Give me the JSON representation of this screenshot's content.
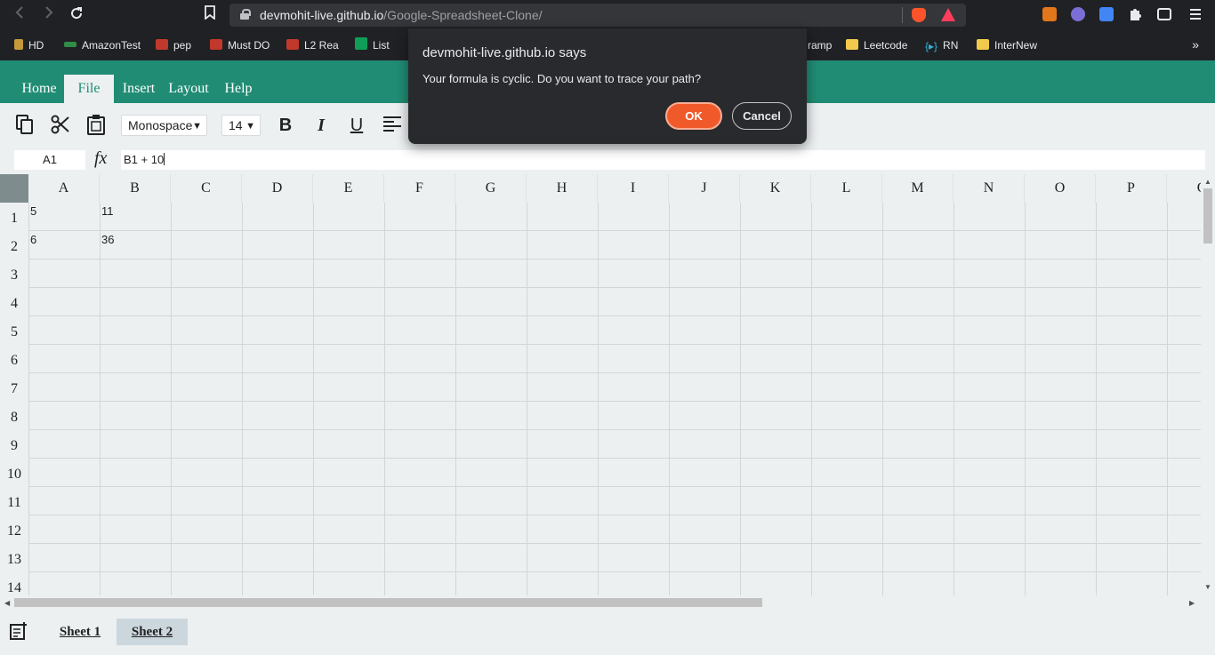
{
  "browser": {
    "url_domain": "devmohit-live.github.io",
    "url_path": "/Google-Spreadsheet-Clone/",
    "bookmarks": [
      {
        "label": "HD",
        "icon": "hd-icon"
      },
      {
        "label": "AmazonTest",
        "icon": "gfg-icon"
      },
      {
        "label": "pep",
        "icon": "pep-icon"
      },
      {
        "label": "Must DO",
        "icon": "pep-icon"
      },
      {
        "label": "L2 Rea",
        "icon": "pep-icon"
      },
      {
        "label": "List",
        "icon": "sheets-icon"
      },
      {
        "label": "ramp",
        "icon": ""
      },
      {
        "label": "Leetcode",
        "icon": "folder-icon"
      },
      {
        "label": "RN",
        "icon": "rn-icon"
      },
      {
        "label": "InterNew",
        "icon": "folder-icon"
      }
    ],
    "more_bookmarks": "»"
  },
  "dialog": {
    "title": "devmohit-live.github.io says",
    "message": "Your formula is cyclic. Do you want to trace your path?",
    "ok_label": "OK",
    "cancel_label": "Cancel"
  },
  "menu": {
    "items": [
      "Home",
      "File",
      "Insert",
      "Layout",
      "Help"
    ],
    "active": "File"
  },
  "toolbar": {
    "font_family": "Monospace",
    "font_size": "14",
    "bold_label": "B",
    "italic_label": "I",
    "underline_label": "U"
  },
  "formula_bar": {
    "cell_address": "A1",
    "fx_label": "fx",
    "formula": "B1 + 10"
  },
  "grid": {
    "columns": [
      "A",
      "B",
      "C",
      "D",
      "E",
      "F",
      "G",
      "H",
      "I",
      "J",
      "K",
      "L",
      "M",
      "N",
      "O",
      "P",
      "Q"
    ],
    "rows": [
      "1",
      "2",
      "3",
      "4",
      "5",
      "6",
      "7",
      "8",
      "9",
      "10",
      "11",
      "12",
      "13",
      "14"
    ],
    "cells": {
      "A1": "5",
      "B1": "11",
      "A2": "6",
      "B2": "36"
    }
  },
  "sheets": {
    "tabs": [
      "Sheet 1",
      "Sheet 2"
    ],
    "active": "Sheet 2"
  },
  "colors": {
    "menubar": "#218c74",
    "background": "#ecf0f1",
    "ok_button": "#f05a2b"
  }
}
